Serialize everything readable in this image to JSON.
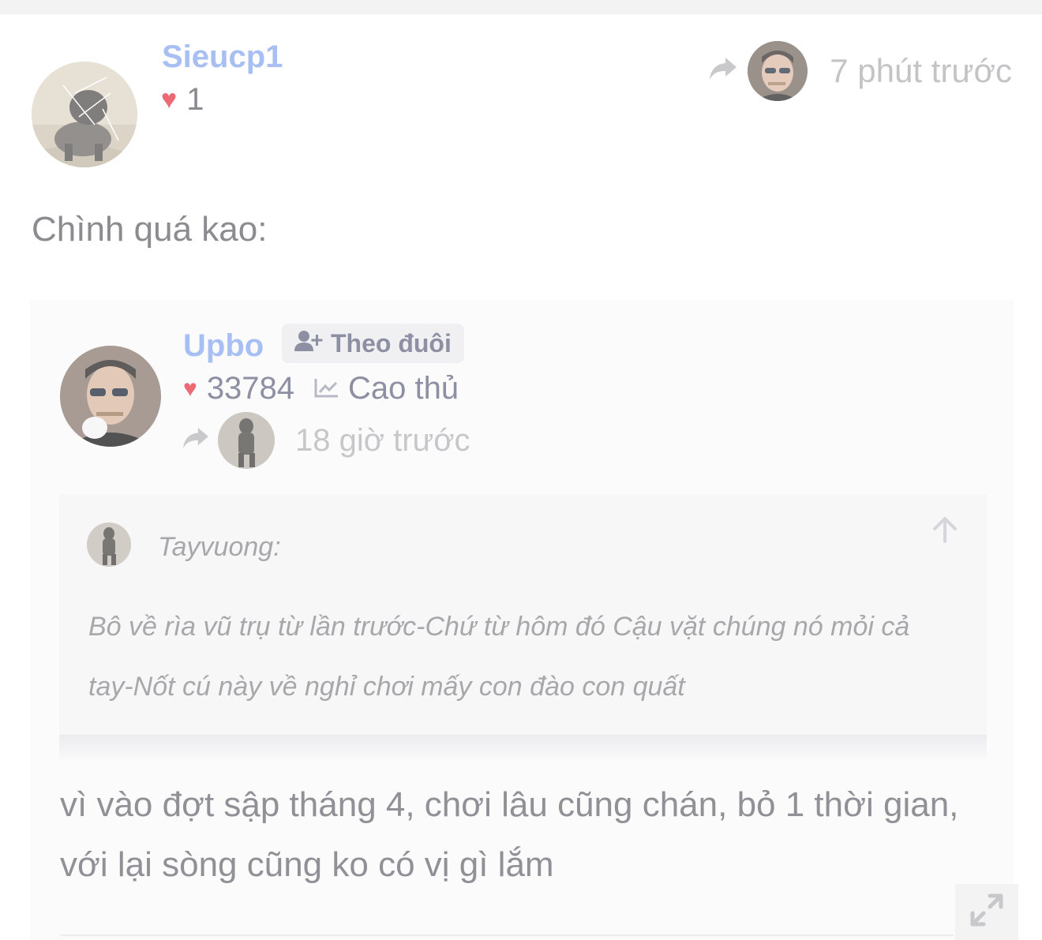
{
  "post": {
    "author": "Sieucp1",
    "likes": "1",
    "time": "7 phút trước",
    "body": "Chình quá kao:"
  },
  "quote": {
    "author": "Upbo",
    "follow_label": "Theo đuôi",
    "likes": "33784",
    "rank": "Cao thủ",
    "time": "18 giờ trước",
    "nested": {
      "author": "Tayvuong:",
      "text": "Bô về rìa vũ trụ từ lần trước-Chứ từ hôm đó Cậu vặt chúng nó mỏi cả tay-Nốt cú này về nghỉ chơi mấy con đào con quất"
    },
    "reply": "vì vào đợt sập tháng 4, chơi lâu cũng chán, bỏ 1 thời gian, với lại sòng cũng ko có vị gì lắm"
  },
  "icons": {
    "share": "share-arrow-icon",
    "heart": "heart-icon",
    "follow": "user-plus-icon",
    "rank": "chart-line-icon",
    "scroll_up": "arrow-up-icon",
    "expand": "expand-icon"
  },
  "colors": {
    "username": "#a7bff2",
    "heart": "#ec6a73"
  }
}
